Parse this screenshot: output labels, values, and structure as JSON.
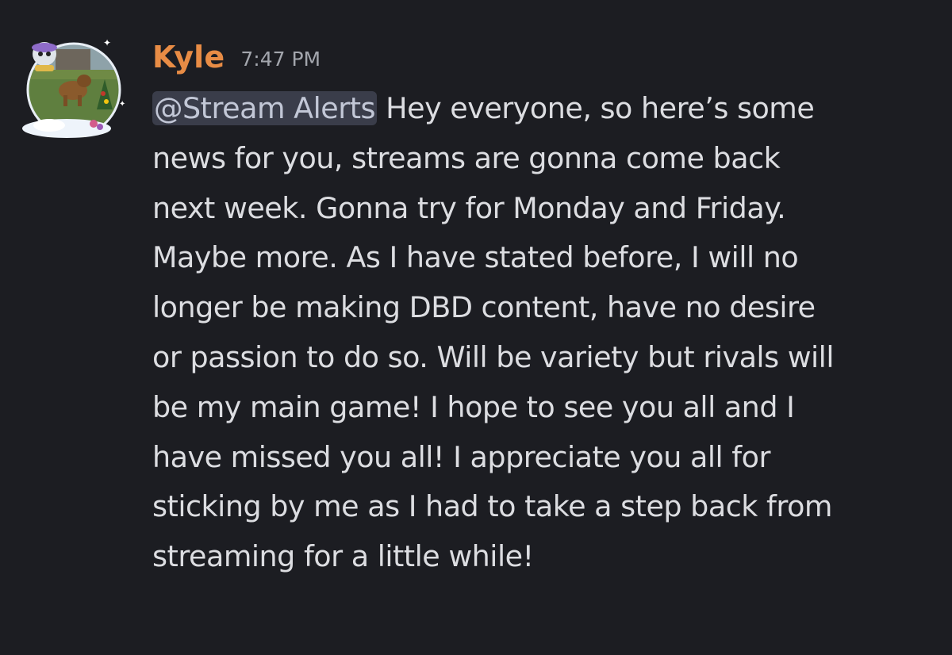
{
  "message": {
    "author": "Kyle",
    "timestamp": "7:47 PM",
    "mention": "@Stream Alerts",
    "lines": [
      " Hey everyone, so here’s some",
      "news for you, streams are gonna come back",
      "next week. Gonna try for Monday and Friday.",
      "Maybe more. As I have stated before, I will no",
      "longer be making DBD content, have no desire",
      "or passion to do so. Will be variety but rivals will",
      "be my main game! I hope to see you all and I",
      "have missed you all! I appreciate you all for",
      "sticking by me as I had to take a step back from",
      "streaming for a little while!"
    ]
  },
  "colors": {
    "background": "#1c1d22",
    "username": "#e88c45",
    "timestamp": "#a3a6ad",
    "text": "#dcdde1",
    "mention_bg": "#3a3d4a",
    "mention_text": "#c2c7d6"
  },
  "icons": {
    "avatar": "avatar-image"
  }
}
